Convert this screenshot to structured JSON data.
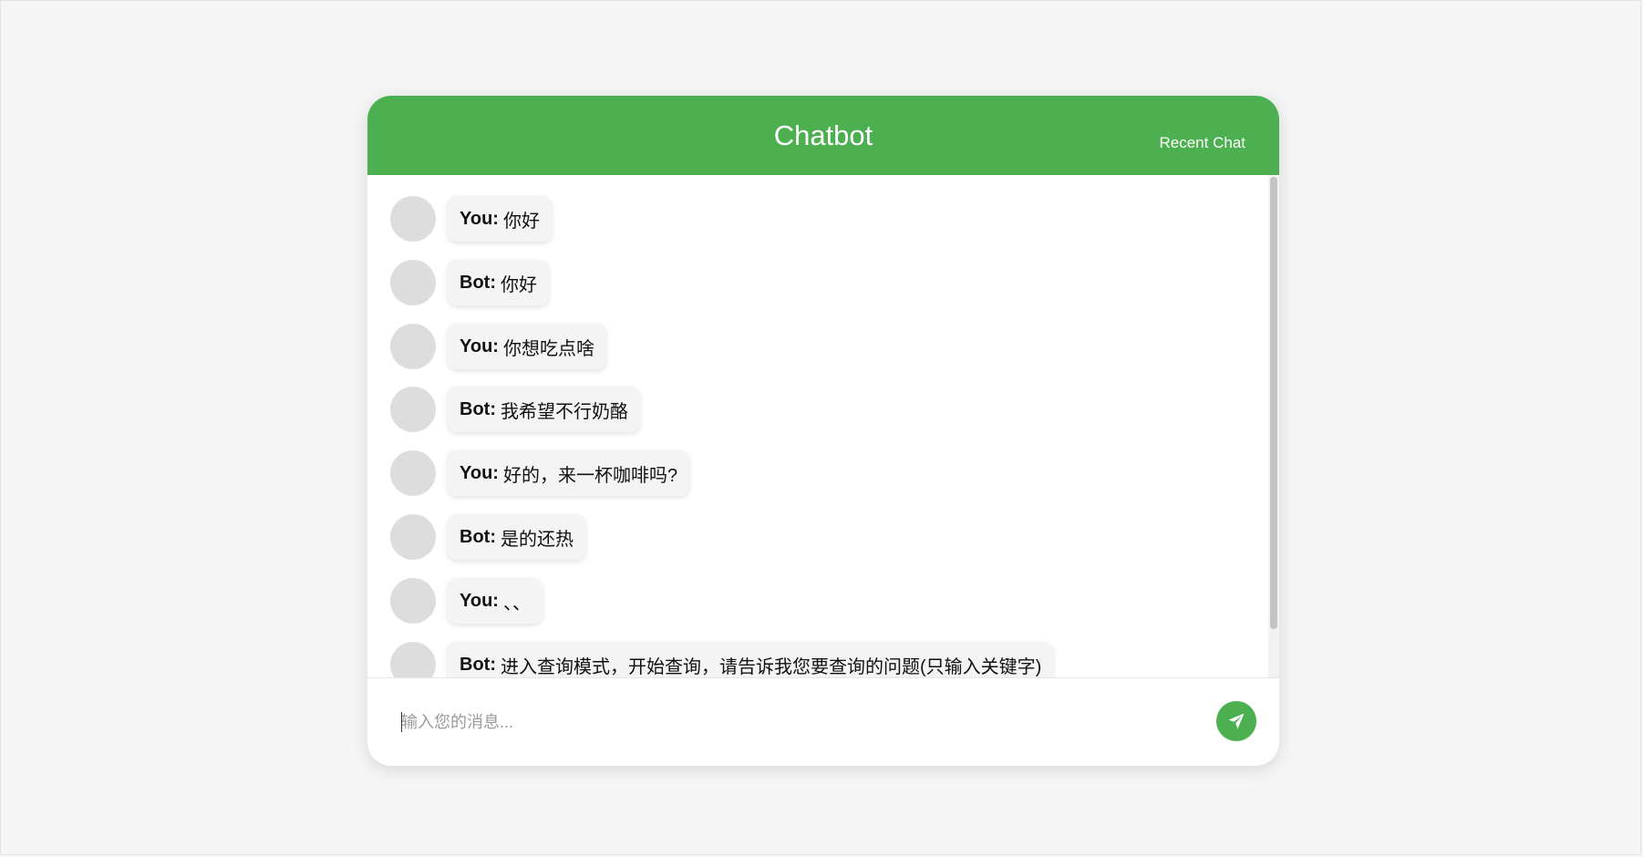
{
  "header": {
    "title": "Chatbot",
    "recent_chat_label": "Recent Chat"
  },
  "messages": [
    {
      "sender": "You:",
      "text": "你好"
    },
    {
      "sender": "Bot:",
      "text": "你好"
    },
    {
      "sender": "You:",
      "text": "你想吃点啥"
    },
    {
      "sender": "Bot:",
      "text": "我希望不行奶酪"
    },
    {
      "sender": "You:",
      "text": "好的，来一杯咖啡吗?"
    },
    {
      "sender": "Bot:",
      "text": "是的还热"
    },
    {
      "sender": "You:",
      "text": "、、"
    },
    {
      "sender": "Bot:",
      "text": "进入查询模式，开始查询，请告诉我您要查询的问题(只输入关键字)"
    }
  ],
  "input": {
    "placeholder": "输入您的消息...",
    "value": ""
  },
  "send_button": {
    "icon": "paper-plane-icon"
  },
  "colors": {
    "accent": "#4caf50",
    "page_background": "#f5f5f5",
    "bubble_background": "#f4f4f4",
    "avatar": "#dddddd"
  }
}
